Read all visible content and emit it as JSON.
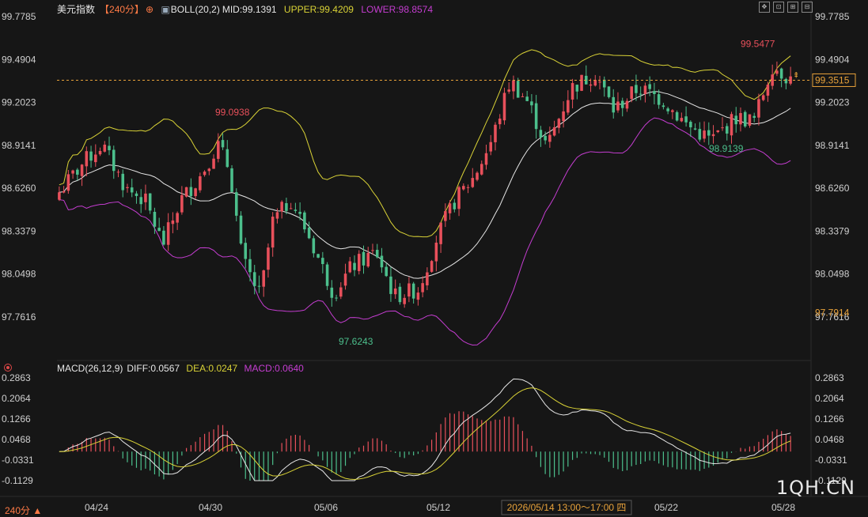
{
  "legend": {
    "symbol": "美元指数",
    "period": "【240分】",
    "boll_name": "BOLL(20,2)",
    "mid": "MID:99.1391",
    "upper": "UPPER:99.4209",
    "lower": "LOWER:98.8574"
  },
  "macd_legend": {
    "name": "MACD(26,12,9)",
    "diff": "DIFF:0.0567",
    "dea": "DEA:0.0247",
    "macd": "MACD:0.0640"
  },
  "period_label": "240分 ▲",
  "watermark": "1QH.CN",
  "current_price": "99.3515",
  "colors": {
    "up": "#e8505b",
    "down": "#4cbf8c",
    "upper": "#d9d236",
    "mid": "#e6e6e6",
    "lower": "#c53dd1",
    "dea": "#d9d236",
    "diff": "#e6e6e6"
  },
  "chart_data": {
    "type": "candlestick",
    "price_axis_ticks": [
      "99.7785",
      "99.4904",
      "99.2023",
      "98.9141",
      "98.6260",
      "98.3379",
      "98.0498",
      "97.7616"
    ],
    "price_range": [
      97.7616,
      99.7785
    ],
    "macd_axis_ticks": [
      "0.2863",
      "0.2064",
      "0.1266",
      "0.0468",
      "-0.0331",
      "-0.1129"
    ],
    "macd_range": [
      -0.1129,
      0.2863
    ],
    "x_labels": [
      "04/24",
      "04/30",
      "05/06",
      "05/12",
      "05/22",
      "05/28"
    ],
    "crosshair_label": "2026/05/14 13:00～17:00 四",
    "ref_line_label": "97.7914",
    "annotations": {
      "high1": "99.0938",
      "low1": "97.6243",
      "high2": "99.5477",
      "low2": "98.9139"
    }
  }
}
